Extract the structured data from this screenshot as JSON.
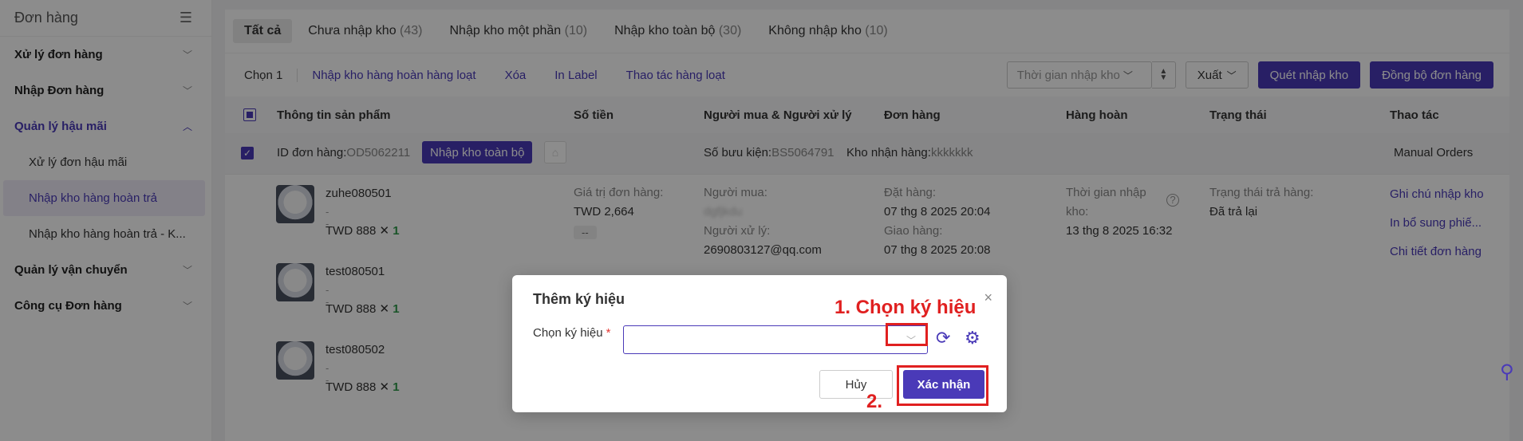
{
  "sidebar": {
    "title": "Đơn hàng",
    "collapse_icon": "menu-collapse-icon",
    "items": [
      {
        "label": "Xử lý đơn hàng"
      },
      {
        "label": "Nhập Đơn hàng"
      },
      {
        "label": "Quản lý hậu mãi"
      },
      {
        "label": "Quản lý vận chuyển"
      },
      {
        "label": "Công cụ Đơn hàng"
      }
    ],
    "subitems": [
      {
        "label": "Xử lý đơn hậu mãi"
      },
      {
        "label": "Nhập kho hàng hoàn trả"
      },
      {
        "label": "Nhập kho hàng hoàn trả - K..."
      }
    ]
  },
  "tabs": [
    {
      "label": "Tất cả",
      "count": ""
    },
    {
      "label": "Chưa nhập kho",
      "count": "(43)"
    },
    {
      "label": "Nhập kho một phần",
      "count": "(10)"
    },
    {
      "label": "Nhập kho toàn bộ",
      "count": "(30)"
    },
    {
      "label": "Không nhập kho",
      "count": "(10)"
    }
  ],
  "toolbar": {
    "selected": "Chọn 1",
    "links": [
      "Nhập kho hàng hoàn hàng loạt",
      "Xóa",
      "In Label",
      "Thao tác hàng loạt"
    ],
    "time_select": "Thời gian nhập kho",
    "export": "Xuất",
    "scan_btn": "Quét nhập kho",
    "sync_btn": "Đồng bộ đơn hàng"
  },
  "columns": [
    "Thông tin sản phẩm",
    "Số tiền",
    "Người mua & Người xử lý",
    "Đơn hàng",
    "Hàng hoàn",
    "Trạng thái",
    "Thao tác"
  ],
  "group": {
    "order_id_label": "ID đơn hàng:",
    "order_id": "OD5062211",
    "tag": "Nhập kho toàn bộ",
    "parcel_label": "Số bưu kiện:",
    "parcel": "BS5064791",
    "warehouse_label": "Kho nhận hàng:",
    "warehouse": "kkkkkkk",
    "source": "Manual Orders"
  },
  "products": [
    {
      "name": "zuhe080501",
      "dash": "--",
      "price": "TWD 888",
      "times": "✕",
      "qty": "1"
    },
    {
      "name": "test080501",
      "dash": "--",
      "price": "TWD 888",
      "times": "✕",
      "qty": "1"
    },
    {
      "name": "test080502",
      "dash": "--",
      "price": "TWD 888",
      "times": "✕",
      "qty": "1"
    }
  ],
  "amount": {
    "label": "Giá trị đơn hàng:",
    "value": "TWD 2,664",
    "badge": "--"
  },
  "buyer": {
    "label": "Người mua:",
    "value": "dgfjkdu",
    "handler_label": "Người xử lý:",
    "handler": "2690803127@qq.com"
  },
  "order": {
    "ordered_label": "Đặt hàng:",
    "ordered": "07 thg 8 2025 20:04",
    "delivered_label": "Giao hàng:",
    "delivered": "07 thg 8 2025 20:08"
  },
  "return": {
    "label": "Thời gian nhập",
    "label2": "kho:",
    "value": "13 thg 8 2025 16:32",
    "help_icon": "question-circle-icon"
  },
  "status": {
    "label": "Trạng thái trả hàng:",
    "value": "Đã trả lại"
  },
  "actions": [
    "Ghi chú nhập kho",
    "In bổ sung phiế...",
    "Chi tiết đơn hàng"
  ],
  "modal": {
    "title": "Thêm ký hiệu",
    "close": "×",
    "field_label": "Chọn ký hiệu",
    "required": "*",
    "cancel": "Hủy",
    "confirm": "Xác nhận"
  },
  "annotations": {
    "step1": "1. Chọn ký hiệu",
    "step2": "2."
  },
  "colors": {
    "primary": "#4a3ab8",
    "annotation": "#e02020",
    "qty": "#2e9a4a"
  }
}
